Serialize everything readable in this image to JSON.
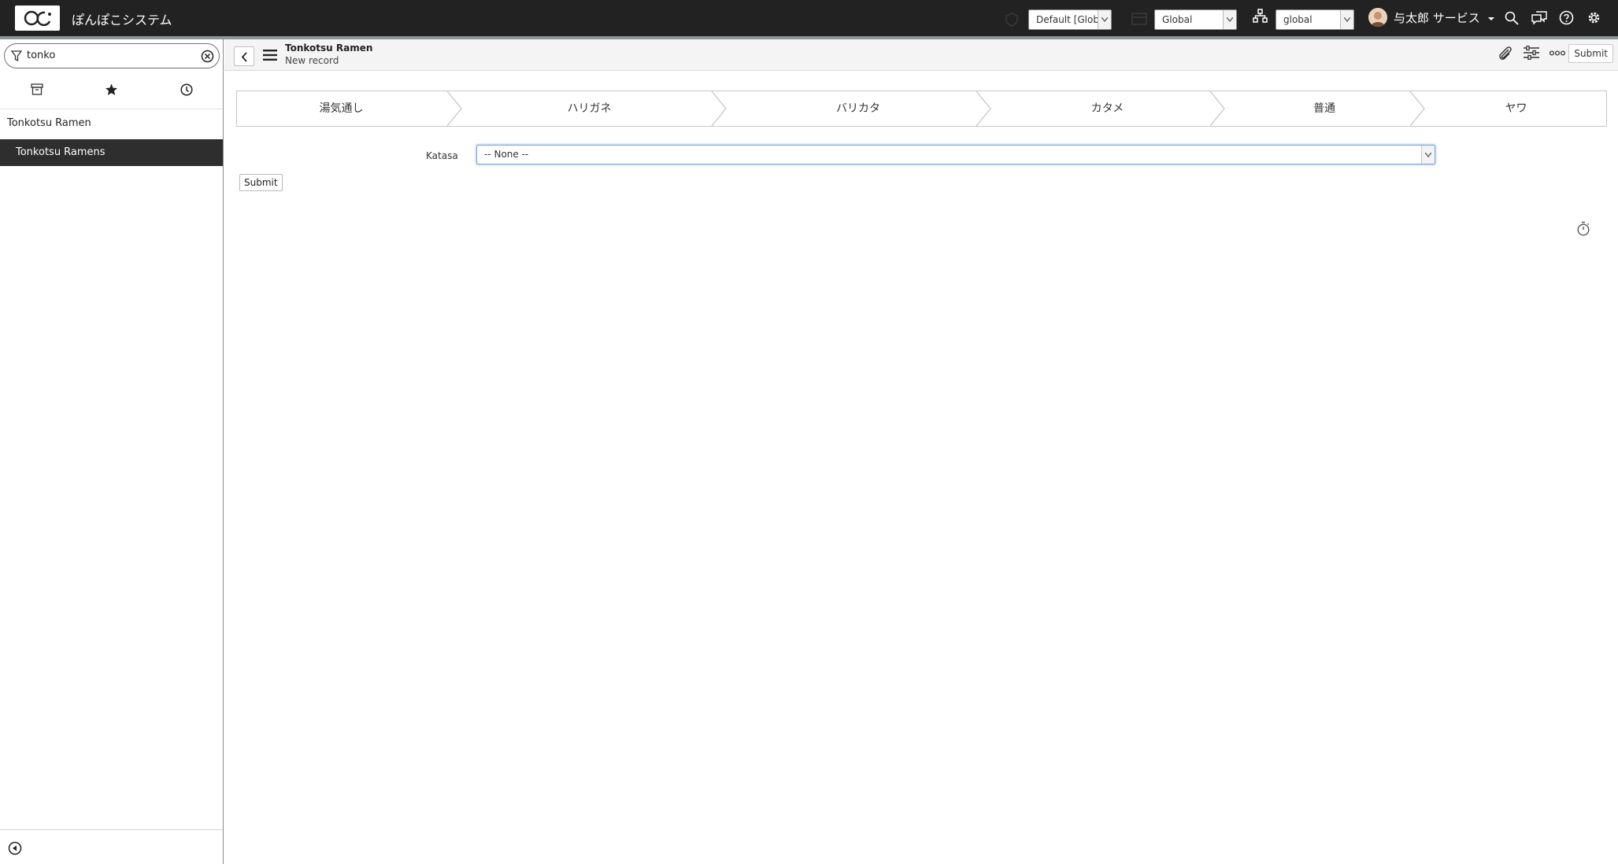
{
  "app": {
    "title": "ぽんぽこシステム",
    "logo_icon": "now-logo-icon"
  },
  "topbar": {
    "update_set": "Default [Global]",
    "application_scope": "Global",
    "domain": "global",
    "user_name": "与太郎 サービス",
    "icons": [
      "shield-icon",
      "package-icon",
      "hierarchy-icon",
      "search-icon",
      "chat-icon",
      "help-icon",
      "gear-icon"
    ]
  },
  "sidebar": {
    "filter_value": "tonko",
    "tabs": [
      "archive-icon",
      "star-icon",
      "clock-icon"
    ],
    "items": [
      {
        "label": "Tonkotsu Ramen",
        "selected": false
      },
      {
        "label": "Tonkotsu Ramens",
        "selected": true
      }
    ]
  },
  "header": {
    "title": "Tonkotsu Ramen",
    "subtitle": "New record",
    "submit_label": "Submit"
  },
  "flow": {
    "steps": [
      "湯気通し",
      "ハリガネ",
      "バリカタ",
      "カタメ",
      "普通",
      "ヤワ"
    ]
  },
  "form": {
    "field_label": "Katasa",
    "field_value": "-- None --",
    "submit_label": "Submit"
  },
  "colors": {
    "topbar": "#222222",
    "selected_nav": "#2e2e2e",
    "focus": "#7aa8e0"
  }
}
